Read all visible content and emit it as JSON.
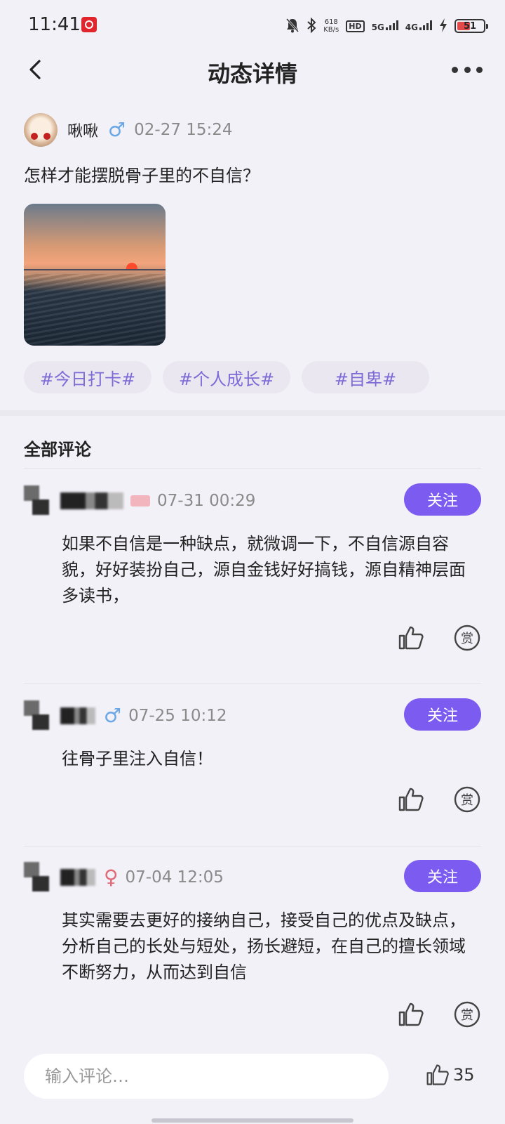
{
  "status_bar": {
    "time": "11:41",
    "net_speed_value": "618",
    "net_speed_unit": "KB/s",
    "hd_label": "HD",
    "net_5g": "5G",
    "net_4g": "4G",
    "battery": "51",
    "icons": [
      "netease-music-icon",
      "mute-bell-icon",
      "bluetooth-icon",
      "charging-icon"
    ]
  },
  "header": {
    "title": "动态详情"
  },
  "post": {
    "author": "啾啾",
    "gender_symbol": "♂",
    "time": "02-27  15:24",
    "text": "怎样才能摆脱骨子里的不自信？",
    "tags": [
      "#今日打卡#",
      "#个人成长#",
      "#自卑#"
    ]
  },
  "comments_section": {
    "title": "全部评论",
    "follow_label": "关注",
    "comments": [
      {
        "time": "07-31  00:29",
        "text": "如果不自信是一种缺点，就微调一下，不自信源自容貌，好好装扮自己，源自金钱好好搞钱，源自精神层面多读书，"
      },
      {
        "gender_symbol": "♂",
        "time": "07-25  10:12",
        "text": "往骨子里注入自信！"
      },
      {
        "gender_symbol": "♀",
        "time": "07-04  12:05",
        "text": "其实需要去更好的接纳自己，接受自己的优点及缺点，分析自己的长处与短处，扬长避短，在自己的擅长领域不断努力，从而达到自信"
      }
    ],
    "reward_label": "赏"
  },
  "bottom_bar": {
    "input_placeholder": "输入评论…",
    "like_count": "35"
  },
  "colors": {
    "accent": "#7c5cf0",
    "tag_text": "#7d6bd6",
    "male": "#6aa7e6",
    "female": "#e26a78",
    "background": "#f3f1f8"
  }
}
